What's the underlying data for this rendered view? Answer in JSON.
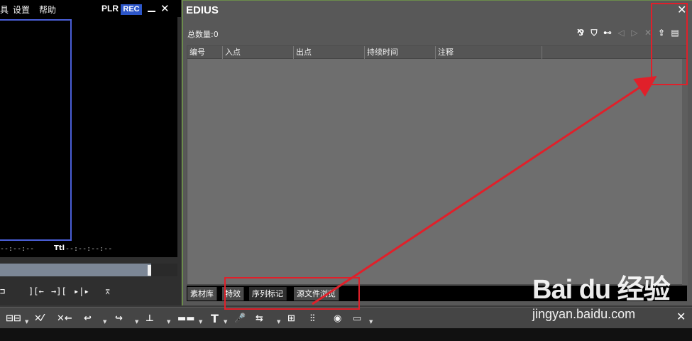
{
  "player": {
    "menu": [
      "具",
      "设置",
      "帮助"
    ],
    "plr_label": "PLR",
    "rec_label": "REC",
    "timecode_left": "--:--:--",
    "timecode_label": "Ttl",
    "timecode_right": "--:--:--:--",
    "controls": [
      "⊐",
      "][←",
      "→][",
      "▸|▸",
      "⌆"
    ]
  },
  "marker_window": {
    "title": "EDIUS",
    "count_label": "总数量:0",
    "columns": [
      "编号",
      "入点",
      "出点",
      "持续时间",
      "注释"
    ],
    "tabs": [
      "素材库",
      "特效",
      "序列标记",
      "源文件浏览"
    ],
    "active_tab": "序列标记"
  },
  "toolbar": {
    "items": [
      "⊟⊟",
      "✕⁄",
      "✕←",
      "↩",
      "↪",
      "⊥",
      "▬▬",
      "T",
      "🎤",
      "⇆",
      "⊞",
      "⫶⫶",
      "◉",
      "▭"
    ]
  },
  "watermark": {
    "brand": "Bai du 经验",
    "url": "jingyan.baidu.com"
  },
  "colors": {
    "accent_blue": "#2c56c9",
    "highlight_red": "#e0202a"
  }
}
